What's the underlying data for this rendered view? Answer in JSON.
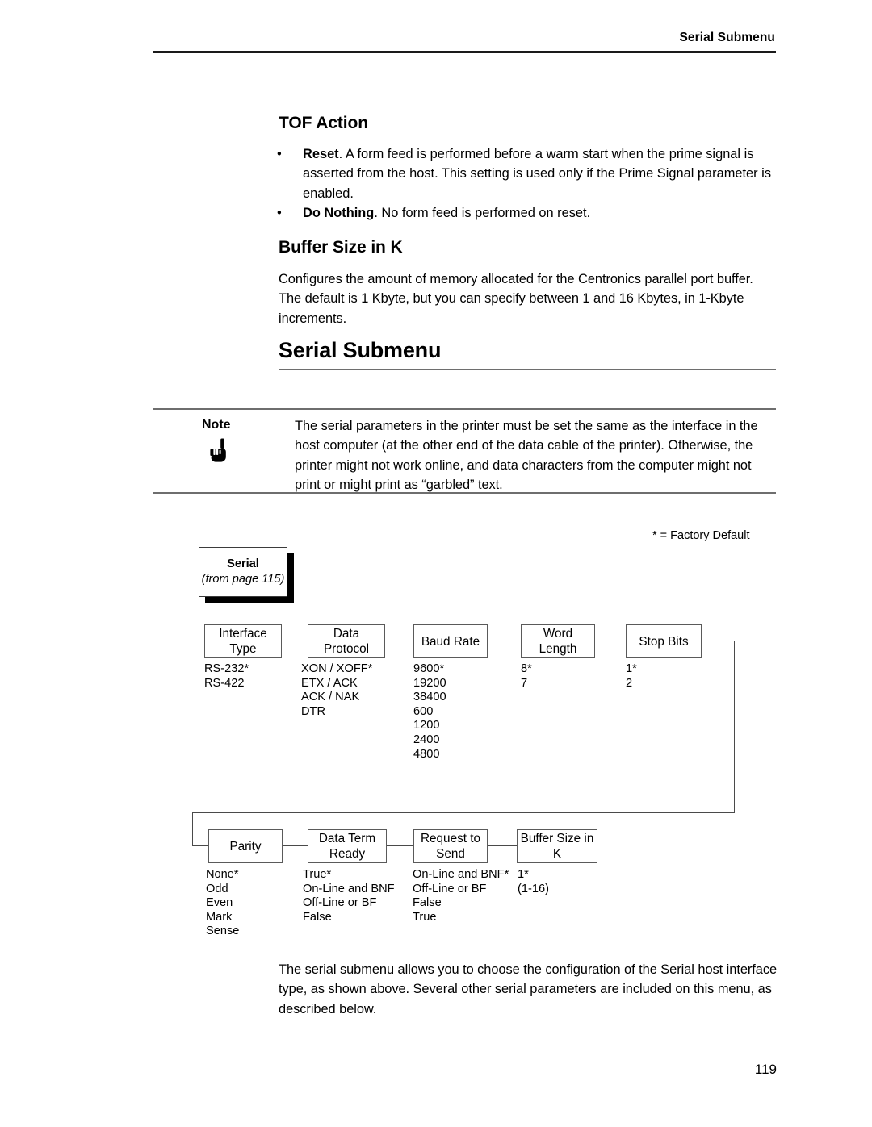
{
  "header": {
    "running_head": "Serial Submenu"
  },
  "sections": [
    {
      "heading": "TOF Action",
      "bullets": [
        {
          "term": "Reset",
          "text": ". A form feed is performed before a warm start when the prime signal is asserted from the host. This setting is used only if the Prime Signal parameter is enabled."
        },
        {
          "term": "Do Nothing",
          "text": ". No form feed is performed on reset."
        }
      ]
    },
    {
      "heading": "Buffer Size in K",
      "body": "Configures the amount of memory allocated for the Centronics parallel port buffer. The default is 1 Kbyte, but you can specify between 1 and 16 Kbytes, in 1-Kbyte increments."
    }
  ],
  "chapter_heading": "Serial Submenu",
  "note": {
    "label": "Note",
    "icon": "pointing-hand-icon",
    "body": "The serial parameters in the printer must be set the same as the interface in the host computer (at the other end of the data cable of the printer). Otherwise, the printer might not work online, and data characters from the computer might not print or might print as “garbled” text."
  },
  "diagram": {
    "legend": "* = Factory Default",
    "root": {
      "title": "Serial",
      "subtitle": "(from page 115)"
    },
    "nodes": [
      {
        "id": "interface-type",
        "lines": [
          "Interface",
          "Type"
        ],
        "options": [
          "RS-232*",
          "RS-422"
        ]
      },
      {
        "id": "data-protocol",
        "lines": [
          "Data",
          "Protocol"
        ],
        "options": [
          "XON / XOFF*",
          "ETX / ACK",
          "ACK / NAK",
          "DTR"
        ]
      },
      {
        "id": "baud-rate",
        "lines": [
          "Baud Rate",
          ""
        ],
        "options": [
          "9600*",
          "19200",
          "38400",
          "600",
          "1200",
          "2400",
          "4800"
        ]
      },
      {
        "id": "word-length",
        "lines": [
          "Word",
          "Length"
        ],
        "options": [
          "8*",
          "7"
        ]
      },
      {
        "id": "stop-bits",
        "lines": [
          "Stop Bits",
          ""
        ],
        "options": [
          "1*",
          "2"
        ]
      },
      {
        "id": "parity",
        "lines": [
          "Parity",
          ""
        ],
        "options": [
          "None*",
          "Odd",
          "Even",
          "Mark",
          "Sense"
        ]
      },
      {
        "id": "data-term-ready",
        "lines": [
          "Data Term",
          "Ready"
        ],
        "options": [
          "True*",
          "On-Line and BNF",
          "Off-Line or BF",
          "False"
        ]
      },
      {
        "id": "request-to-send",
        "lines": [
          "Request to",
          "Send"
        ],
        "options": [
          "On-Line and BNF*",
          "Off-Line or BF",
          "False",
          "True"
        ]
      },
      {
        "id": "buffer-size-in-k",
        "lines": [
          "Buffer Size in",
          "K"
        ],
        "options": [
          "1*",
          "(1-16)"
        ]
      }
    ]
  },
  "closing_paragraph": "The serial submenu allows you to choose the configuration of the Serial host interface type, as shown above. Several other serial parameters are included on this menu, as described below.",
  "page_number": "119"
}
